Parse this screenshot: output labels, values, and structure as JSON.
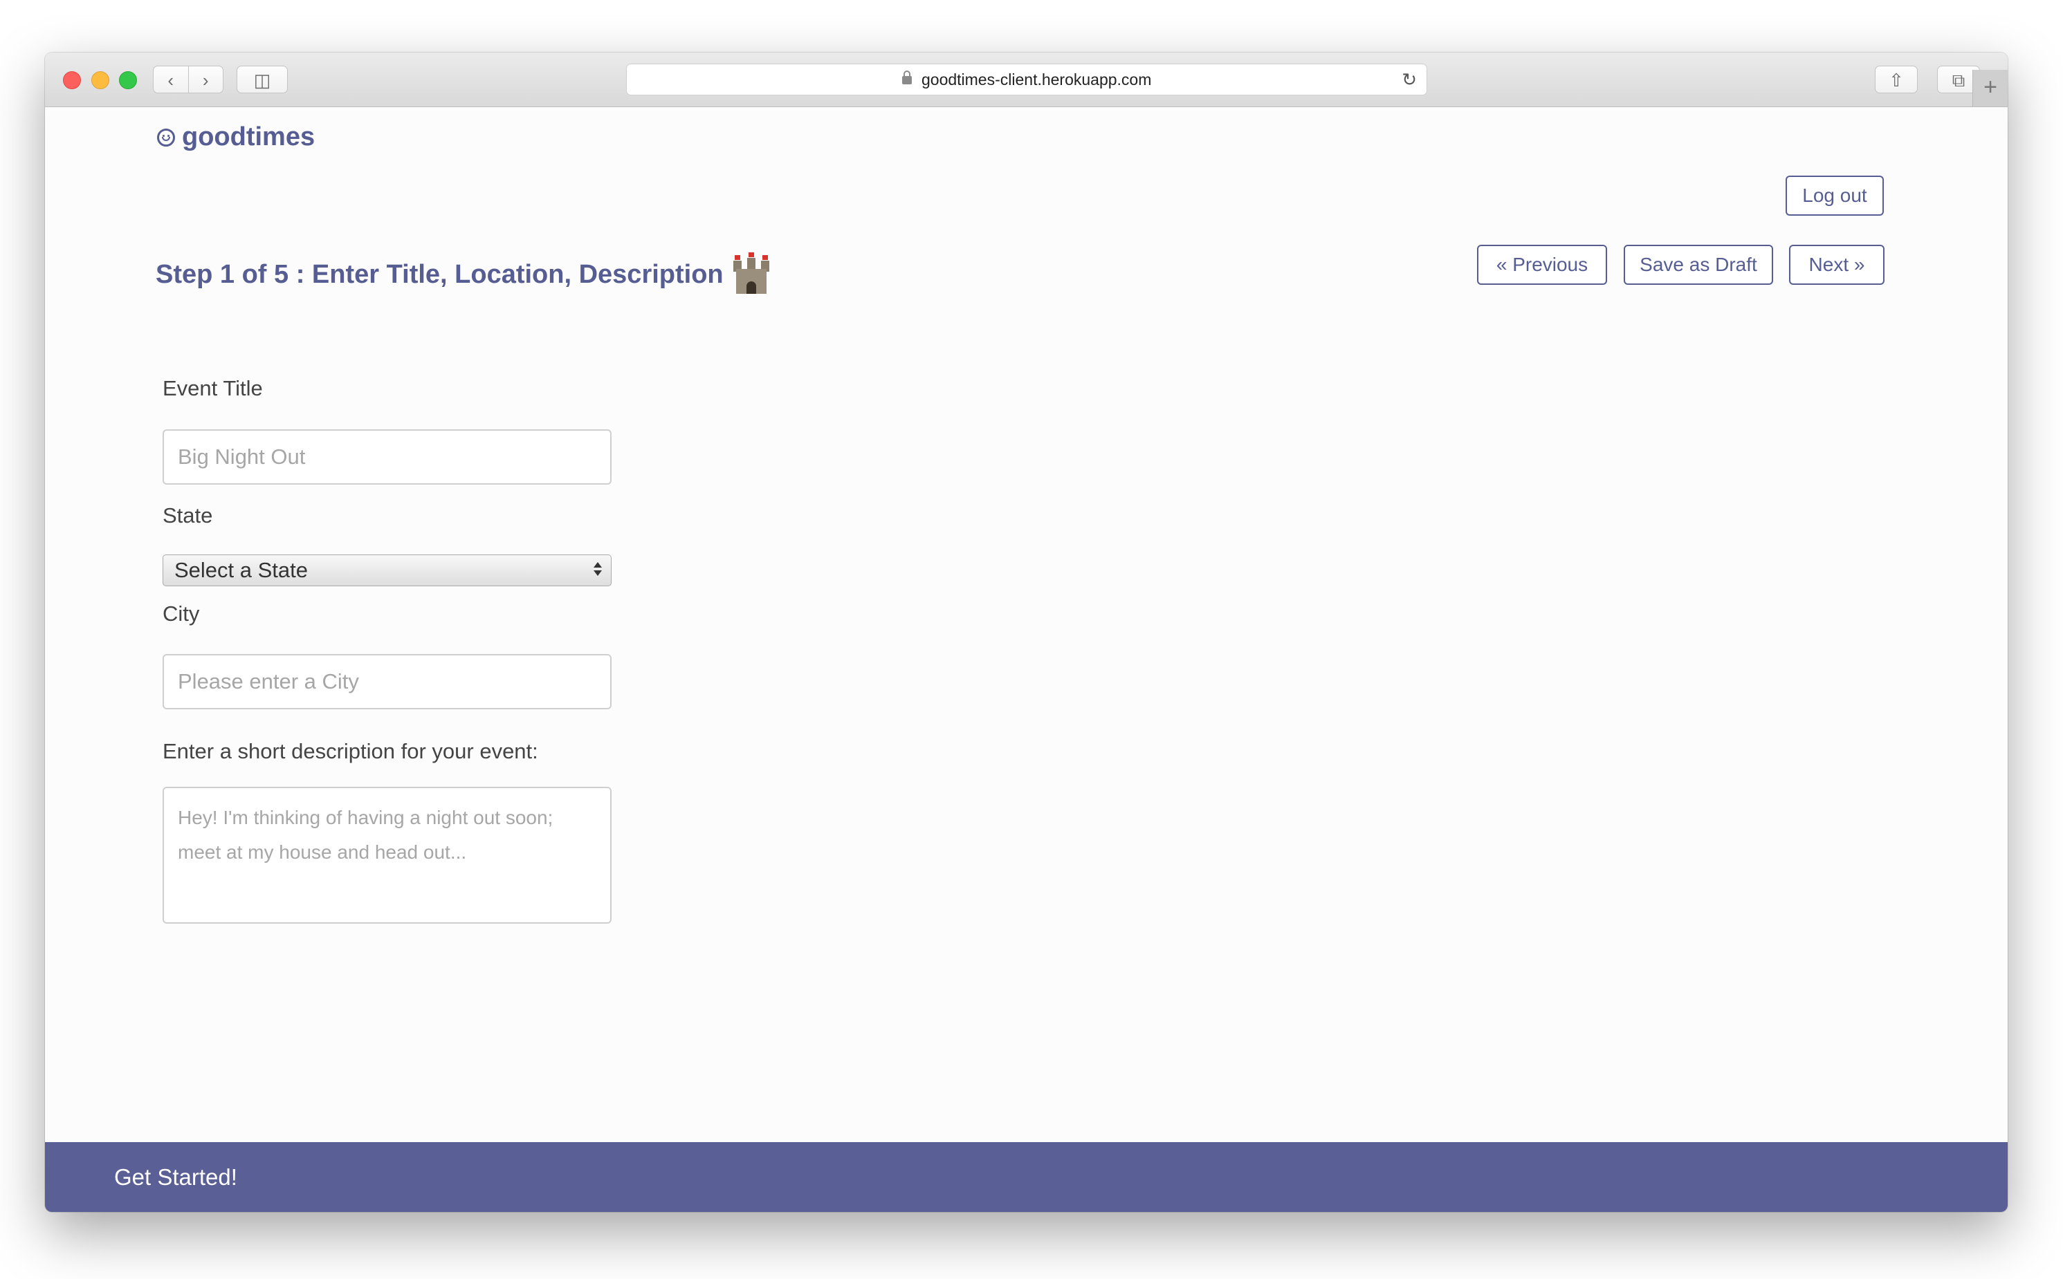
{
  "browser": {
    "url": "goodtimes-client.herokuapp.com",
    "back_label": "‹",
    "forward_label": "›",
    "reload_label": "↻",
    "newtab_label": "+"
  },
  "header": {
    "brand": "goodtimes",
    "logout_label": "Log out"
  },
  "wizard": {
    "step_title": "Step 1 of 5 : Enter Title, Location, Description",
    "previous_label": "« Previous",
    "draft_label": "Save as Draft",
    "next_label": "Next »"
  },
  "form": {
    "title_label": "Event Title",
    "title_placeholder": "Big Night Out",
    "state_label": "State",
    "state_selected": "Select a State",
    "city_label": "City",
    "city_placeholder": "Please enter a City",
    "description_label": "Enter a short description for your event:",
    "description_placeholder": "Hey! I'm thinking of having a night out soon; meet at my house and head out..."
  },
  "footer": {
    "text": "Get Started!"
  },
  "colors": {
    "accent": "#565d92",
    "footer_bg": "#5a5f96"
  }
}
